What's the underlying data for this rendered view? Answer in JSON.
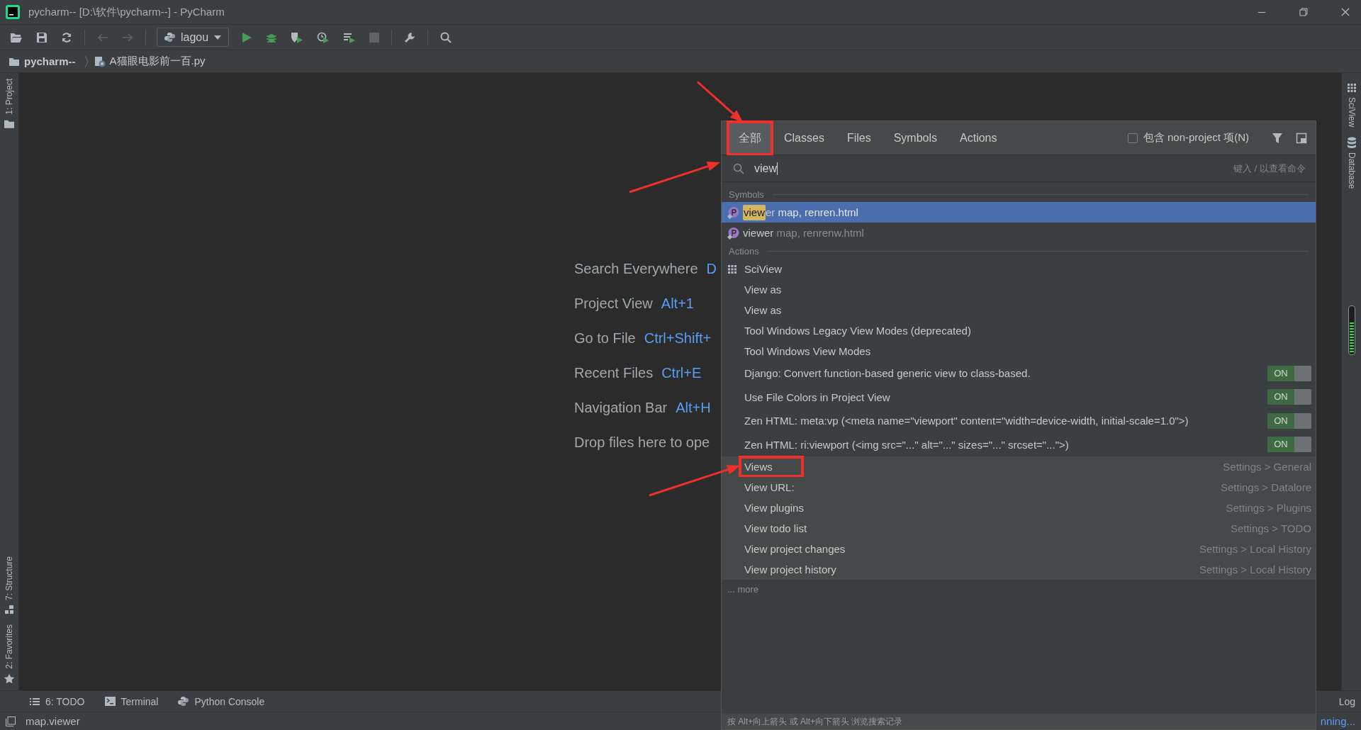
{
  "window": {
    "title": "pycharm-- [D:\\软件\\pycharm--] - PyCharm"
  },
  "toolbar": {
    "run_configuration": "lagou"
  },
  "breadcrumb": [
    "pycharm--",
    "A猫眼电影前一百.py"
  ],
  "left_stripe": [
    {
      "label": "1: Project"
    },
    {
      "label": "7: Structure"
    },
    {
      "label": "2: Favorites"
    }
  ],
  "right_stripe": [
    {
      "label": "SciView"
    },
    {
      "label": "Database"
    }
  ],
  "welcome": [
    {
      "label": "Search Everywhere",
      "shortcut": "D"
    },
    {
      "label": "Project View",
      "shortcut": "Alt+1"
    },
    {
      "label": "Go to File",
      "shortcut": "Ctrl+Shift+"
    },
    {
      "label": "Recent Files",
      "shortcut": "Ctrl+E"
    },
    {
      "label": "Navigation Bar",
      "shortcut": "Alt+H"
    },
    {
      "label": "Drop files here to ope"
    }
  ],
  "popup": {
    "tabs": [
      {
        "label": "全部",
        "selected": true,
        "highlighted": true,
        "arrow": true
      },
      {
        "label": "Classes",
        "selected": false
      },
      {
        "label": "Files",
        "selected": false
      },
      {
        "label": "Symbols",
        "selected": false
      },
      {
        "label": "Actions",
        "selected": false
      }
    ],
    "include_non_project": {
      "label": "包含 non-project 项(N)",
      "checked": false
    },
    "search": {
      "value": "view",
      "hint": "键入 / 以查看命令",
      "arrow": true
    },
    "sections": [
      {
        "title": "Symbols",
        "items": [
          {
            "kind": "symbol",
            "matched": "view",
            "name": "er",
            "location": "map, renren.html",
            "selected": true
          },
          {
            "kind": "symbol",
            "name": "viewer",
            "location": "map, renrenw.html",
            "selected": false
          }
        ]
      },
      {
        "title": "Actions",
        "items": [
          {
            "kind": "toolwindow",
            "label": "SciView",
            "selected": false
          },
          {
            "kind": "action",
            "label": "View as",
            "selected": false
          },
          {
            "kind": "action",
            "label": "View as",
            "selected": false
          },
          {
            "kind": "action",
            "label": "Tool Windows Legacy View Modes (deprecated)",
            "selected": false
          },
          {
            "kind": "action",
            "label": "Tool Windows View Modes",
            "selected": false
          },
          {
            "kind": "toggle",
            "label": "Django: Convert function-based generic view to class-based.",
            "state_label": "ON",
            "on": true,
            "selected": false
          },
          {
            "kind": "toggle",
            "label": "Use File Colors in Project View",
            "state_label": "ON",
            "on": true,
            "selected": false
          },
          {
            "kind": "toggle",
            "label": "Zen HTML: meta:vp (<meta name=\"viewport\" content=\"width=device-width, initial-scale=1.0\">)",
            "state_label": "ON",
            "on": true,
            "selected": false
          },
          {
            "kind": "toggle",
            "label": "Zen HTML: ri:viewport (<img src=\"...\" alt=\"...\" sizes=\"...\" srcset=\"...\">)",
            "state_label": "ON",
            "on": true,
            "selected": false
          },
          {
            "kind": "setting",
            "label": "Views",
            "path": "Settings > General",
            "highlighted": true,
            "arrow": true,
            "selected": false
          },
          {
            "kind": "setting",
            "label": "View URL:",
            "path": "Settings > Datalore",
            "selected": false
          },
          {
            "kind": "setting",
            "label": "View plugins",
            "path": "Settings > Plugins",
            "selected": false
          },
          {
            "kind": "setting",
            "label": "View todo list",
            "path": "Settings > TODO",
            "selected": false
          },
          {
            "kind": "setting",
            "label": "View project changes",
            "path": "Settings > Local History",
            "selected": false
          },
          {
            "kind": "setting",
            "label": "View project history",
            "path": "Settings > Local History",
            "selected": false
          }
        ]
      }
    ],
    "more": "... more",
    "footer": "按 Alt+向上箭头 或 Alt+向下箭头 浏览搜索记录"
  },
  "bottom_bar": {
    "tabs": [
      {
        "label": "6: TODO"
      },
      {
        "label": "Terminal"
      },
      {
        "label": "Python Console"
      }
    ],
    "right_tabs": [
      "Log"
    ]
  },
  "status_bar": {
    "message": "map.viewer",
    "progress": "nning..."
  }
}
